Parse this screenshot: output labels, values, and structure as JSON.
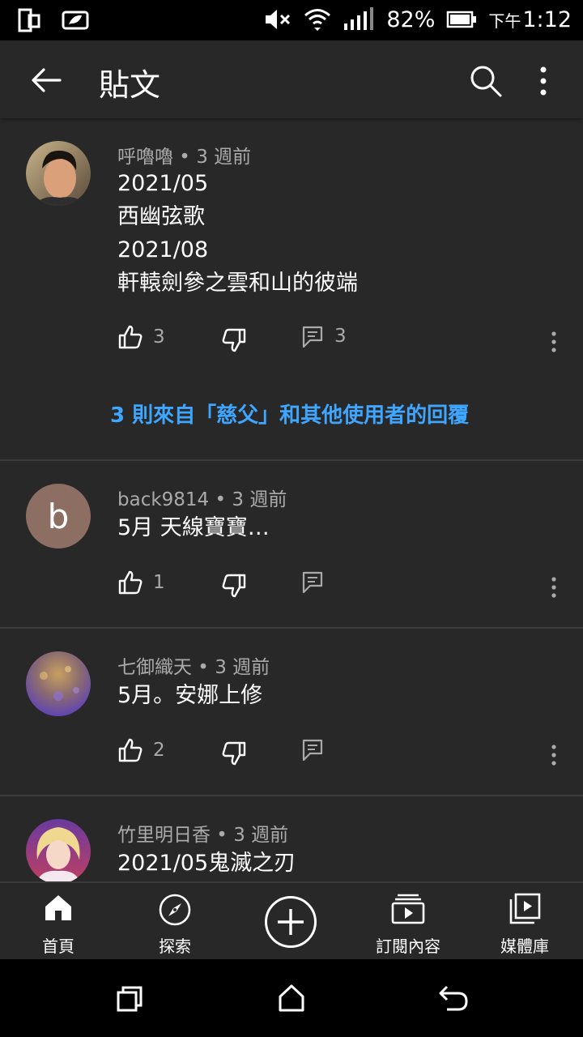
{
  "status_bar": {
    "battery": "82%",
    "time_prefix": "下午",
    "time": "1:12"
  },
  "header": {
    "title": "貼文"
  },
  "comments": [
    {
      "author": "呼嚕嚕",
      "age": "3 週前",
      "lines": [
        "2021/05",
        "西幽弦歌",
        "2021/08",
        "軒轅劍參之雲和山的彼端"
      ],
      "likes": "3",
      "reply_count": "3",
      "replies_link": "3 則來自「慈父」和其他使用者的回覆"
    },
    {
      "author": "back9814",
      "age": "3 週前",
      "avatar_letter": "b",
      "avatar_color": "#8d6e63",
      "lines": [
        "5月 天線寶寶…"
      ],
      "likes": "1"
    },
    {
      "author": "七御織天",
      "age": "3 週前",
      "lines": [
        "5月。安娜上修"
      ],
      "likes": "2"
    },
    {
      "author": "竹里明日香",
      "age": "3 週前",
      "lines": [
        "2021/05鬼滅之刃"
      ]
    }
  ],
  "bottom_nav": [
    {
      "label": "首頁",
      "icon": "home-icon"
    },
    {
      "label": "探索",
      "icon": "explore-icon"
    },
    {
      "label": "",
      "icon": "create-icon"
    },
    {
      "label": "訂閱內容",
      "icon": "subscriptions-icon"
    },
    {
      "label": "媒體庫",
      "icon": "library-icon"
    }
  ],
  "colors": {
    "background": "#282828",
    "link": "#3ea6ff",
    "secondary_text": "#aaaaaa"
  }
}
